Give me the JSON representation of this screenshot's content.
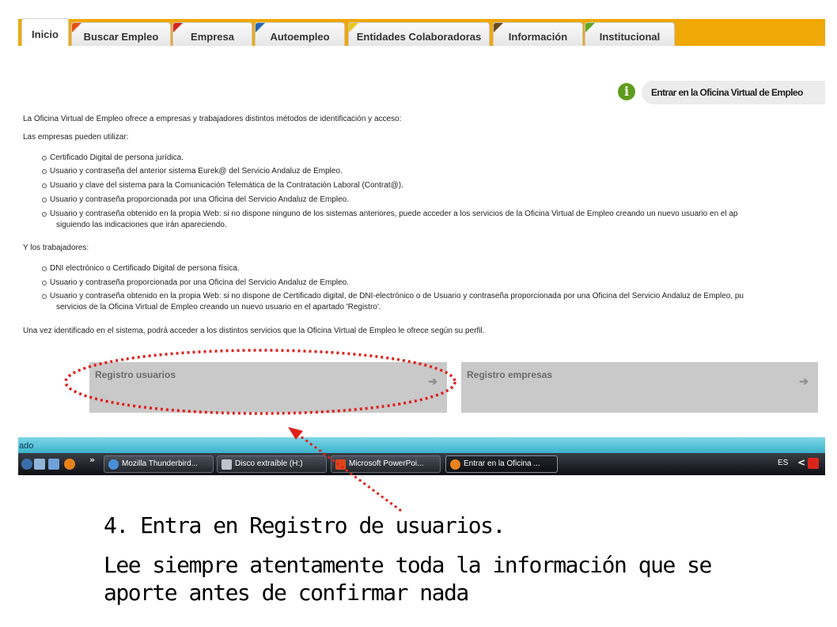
{
  "colors": {
    "nav_bar": "#f0a808",
    "button_grey": "#c9c9c9",
    "annotation_red": "#e0201a",
    "status_bar": "#3bb3cc",
    "taskbar": "#1a1d22",
    "info_icon": "#5f9b1c"
  },
  "nav": {
    "tabs": [
      {
        "label": "Inicio",
        "corner_color": "",
        "active": true
      },
      {
        "label": "Buscar Empleo",
        "corner_color": "#e8501a"
      },
      {
        "label": "Empresa",
        "corner_color": "#d8231c"
      },
      {
        "label": "Autoempleo",
        "corner_color": "#2566b5"
      },
      {
        "label": "Entidades Colaboradoras",
        "corner_color": "#e8c81a"
      },
      {
        "label": "Información",
        "corner_color": "#6b4a1e"
      },
      {
        "label": "Institucional",
        "corner_color": "#5fa820"
      }
    ]
  },
  "login": {
    "icon": "info-icon",
    "label": "Entrar en la Oficina Virtual de Empleo"
  },
  "content": {
    "intro": "La Oficina Virtual de Empleo ofrece a empresas y trabajadores distintos métodos de identificación y acceso:",
    "companies_heading": "Las empresas pueden utilizar:",
    "companies_items": [
      "Certificado Digital de persona jurídica.",
      "Usuario y contraseña del anterior sistema Eurek@ del Servicio Andaluz de Empleo.",
      "Usuario y clave del sistema para la Comunicación Telemática de la Contratación Laboral (Contrat@).",
      "Usuario y contraseña proporcionada por una Oficina del Servicio Andaluz de Empleo.",
      "Usuario y contraseña obtenido en la propia Web: si no dispone ninguno de los sistemas anteriores, puede acceder a los servicios de la Oficina Virtual de Empleo creando un nuevo usuario en el ap"
    ],
    "companies_item5_cont": "siguiendo las indicaciones que irán apareciendo.",
    "workers_heading": "Y los trabajadores:",
    "workers_items": [
      "DNI electrónico o Certificado Digital de persona física.",
      "Usuario y contraseña proporcionada por una Oficina del Servicio Andaluz de Empleo.",
      "Usuario y contraseña obtenido en la propia Web: si no dispone de Certificado digital, de DNI-electrónico o de Usuario y contraseña proporcionada por una Oficina del Servicio Andaluz de Empleo, pu"
    ],
    "workers_item3_cont": "servicios de la Oficina Virtual de Empleo creando un nuevo usuario en el apartado 'Registro'.",
    "outro": "Una vez identificado en el sistema, podrá acceder a los distintos servicios que la Oficina Virtual de Empleo le ofrece según su perfil."
  },
  "buttons": {
    "register_users": "Registro usuarios",
    "register_companies": "Registro empresas",
    "arrow": "➔"
  },
  "status_bar": {
    "text": "ado"
  },
  "taskbar": {
    "chevron": "»",
    "items": [
      {
        "label": "Mozilla Thunderbird...",
        "icon": "thunderbird-icon",
        "icon_color": "#4a8fd8"
      },
      {
        "label": "Disco extraíble (H:)",
        "icon": "drive-icon",
        "icon_color": "#bfc4cc"
      },
      {
        "label": "Microsoft PowerPoi...",
        "icon": "powerpoint-icon",
        "icon_color": "#d9481c"
      },
      {
        "label": "Entrar en la Oficina ...",
        "icon": "firefox-icon",
        "icon_color": "#e8821c"
      }
    ],
    "tray_text": "ES",
    "tray_chevron": "<"
  },
  "caption": {
    "line1": "4. Entra en Registro de usuarios.",
    "line2": "Lee siempre atentamente toda la información que se",
    "line3": "aporte antes de confirmar nada"
  }
}
